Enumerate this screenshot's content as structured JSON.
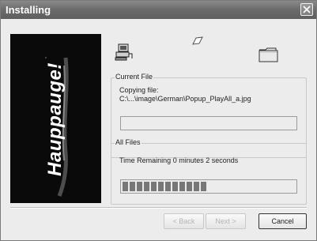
{
  "window": {
    "title": "Installing"
  },
  "banner": {
    "brand_text": "Hauppauge!"
  },
  "icons": [
    "computer-icon",
    "paper-icon",
    "folder-icon"
  ],
  "current_file": {
    "legend": "Current File",
    "line1": "Copying file:",
    "line2": "C:\\...\\image\\German\\Popup_PlayAll_a.jpg",
    "progress": 0
  },
  "all_files": {
    "legend": "All Files",
    "time_remaining": "Time Remaining 0 minutes 2 seconds",
    "progress_blocks_filled": 12
  },
  "buttons": {
    "back": "< Back",
    "next": "Next >",
    "cancel": "Cancel"
  }
}
